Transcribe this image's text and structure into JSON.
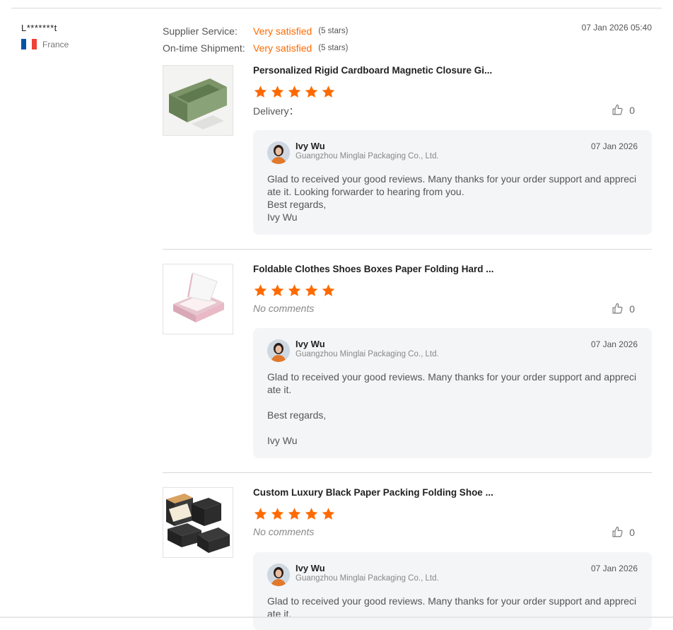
{
  "reviewer": {
    "name": "L*******t",
    "country": "France"
  },
  "ratings": {
    "supplier_service": {
      "label": "Supplier Service:",
      "value": "Very satisfied",
      "stars": "(5 stars)"
    },
    "ontime_shipment": {
      "label": "On-time Shipment:",
      "value": "Very satisfied",
      "stars": "(5 stars)"
    }
  },
  "review_date": "07 Jan 2026 05:40",
  "colors": {
    "accent": "#ff6a00",
    "reply_bg": "#f4f5f7"
  },
  "items": [
    {
      "title": "Personalized Rigid Cardboard Magnetic Closure Gi...",
      "rating": 5,
      "comment": "Delivery：",
      "likes": "0",
      "reply": {
        "name": "Ivy Wu",
        "company": "Guangzhou Minglai Packaging Co., Ltd.",
        "date": "07 Jan 2026",
        "lines": [
          "Glad to received your good reviews. Many thanks for your order support and appreci",
          "ate it.  Looking forwarder to hearing from you.",
          "Best regards,",
          "Ivy Wu"
        ]
      }
    },
    {
      "title": "Foldable Clothes Shoes Boxes Paper Folding Hard ...",
      "rating": 5,
      "comment": "No comments",
      "likes": "0",
      "reply": {
        "name": "Ivy Wu",
        "company": "Guangzhou Minglai Packaging Co., Ltd.",
        "date": "07 Jan 2026",
        "lines": [
          "Glad to received your good reviews. Many thanks for your order support and appreci",
          "ate it.",
          "",
          "Best regards,",
          "",
          "Ivy Wu"
        ]
      }
    },
    {
      "title": "Custom Luxury Black Paper Packing Folding Shoe ...",
      "rating": 5,
      "comment": "No comments",
      "likes": "0",
      "reply": {
        "name": "Ivy Wu",
        "company": "Guangzhou Minglai Packaging Co., Ltd.",
        "date": "07 Jan 2026",
        "lines": [
          "Glad to received your good reviews. Many thanks for your order support and appreci",
          "ate it."
        ]
      }
    }
  ]
}
